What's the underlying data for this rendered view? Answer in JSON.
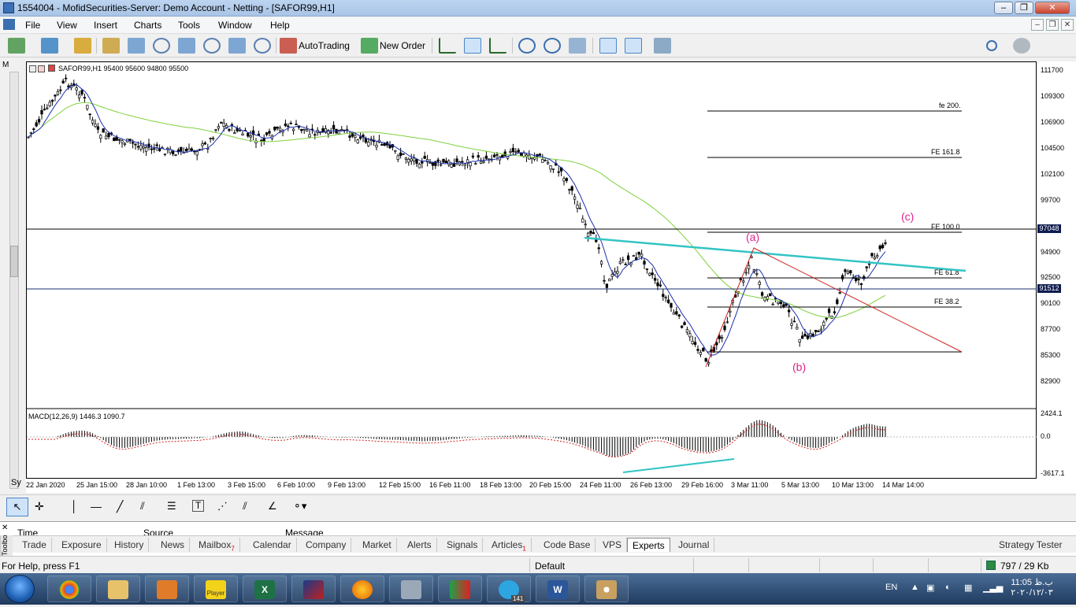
{
  "window": {
    "title": "1554004 - MofidSecurities-Server: Demo Account - Netting - [SAFOR99,H1]"
  },
  "menu": [
    "File",
    "View",
    "Insert",
    "Charts",
    "Tools",
    "Window",
    "Help"
  ],
  "toolbar": {
    "autotrading": "AutoTrading",
    "new_order": "New Order"
  },
  "chart": {
    "header": "SAFOR99,H1  95400 95600 94800 95500",
    "macd_label": "MACD(12,26,9) 1446.3 1090.7",
    "price_ticks": [
      "111700",
      "109300",
      "106900",
      "104500",
      "102100",
      "99700",
      "97048",
      "94900",
      "92500",
      "91512",
      "90100",
      "87700",
      "85300",
      "82900"
    ],
    "current_price_tag": "97048",
    "line_tag": "91512",
    "macd_ticks": [
      "2424.1",
      "0.0",
      "-3617.1"
    ],
    "time_ticks": [
      "22 Jan 2020",
      "25 Jan 15:00",
      "28 Jan 10:00",
      "1 Feb 13:00",
      "3 Feb 15:00",
      "6 Feb 10:00",
      "9 Feb 13:00",
      "12 Feb 15:00",
      "16 Feb 11:00",
      "18 Feb 13:00",
      "20 Feb 15:00",
      "24 Feb 11:00",
      "26 Feb 13:00",
      "29 Feb 16:00",
      "3 Mar 11:00",
      "5 Mar 13:00",
      "10 Mar 13:00",
      "14 Mar 14:00"
    ],
    "fibo_levels": [
      "fe 200.",
      "FE 161.8",
      "FE 100.0",
      "FE 61.8",
      "FE 38.2"
    ],
    "wave_labels": [
      "(a)",
      "(b)",
      "(c)"
    ]
  },
  "terminal": {
    "columns": [
      "Time",
      "Source",
      "Message"
    ],
    "side_label": "Toolbox",
    "tabs": [
      {
        "label": "Trade"
      },
      {
        "label": "Exposure"
      },
      {
        "label": "History"
      },
      {
        "label": "News"
      },
      {
        "label": "Mailbox",
        "badge": "7"
      },
      {
        "label": "Calendar"
      },
      {
        "label": "Company"
      },
      {
        "label": "Market"
      },
      {
        "label": "Alerts"
      },
      {
        "label": "Signals"
      },
      {
        "label": "Articles",
        "badge": "1"
      },
      {
        "label": "Code Base"
      },
      {
        "label": "VPS"
      },
      {
        "label": "Experts"
      },
      {
        "label": "Journal"
      }
    ],
    "active_tab": "Experts",
    "strategy_tester": "Strategy Tester"
  },
  "status": {
    "help": "For Help, press F1",
    "profile": "Default",
    "traffic": "797 / 29 Kb"
  },
  "taskbar": {
    "lang": "EN",
    "time": "11:05 ب.ظ",
    "date": "۲۰۲۰/۱۲/۰۳",
    "telegram_badge": "141",
    "player_label": "Player"
  },
  "colors": {
    "bull_line": "#7fd13b",
    "trendline": "#33c4c4",
    "wave": "#cc1f1f",
    "labels": "#e0218a"
  }
}
